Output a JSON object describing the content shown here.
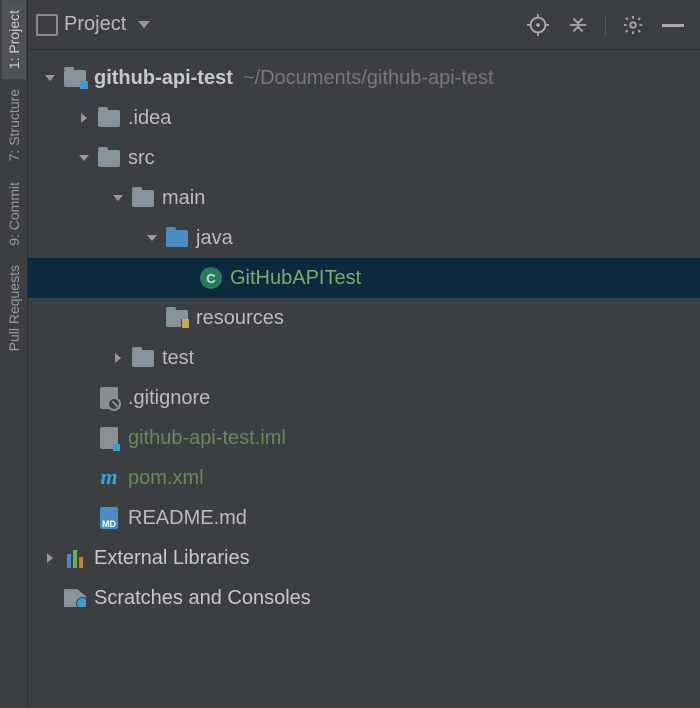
{
  "header": {
    "title": "Project"
  },
  "sideTabs": [
    "1: Project",
    "7: Structure",
    "9: Commit",
    "Pull Requests"
  ],
  "tree": {
    "root": {
      "name": "github-api-test",
      "path": "~/Documents/github-api-test"
    },
    "idea": ".idea",
    "src": "src",
    "main": "main",
    "java": "java",
    "class": "GitHubAPITest",
    "resources": "resources",
    "test": "test",
    "gitignore": ".gitignore",
    "iml": "github-api-test.iml",
    "pom": "pom.xml",
    "readme": "README.md",
    "external": "External Libraries",
    "scratches": "Scratches and Consoles"
  },
  "icons": {
    "classLetter": "C",
    "mdLabel": "MD",
    "mavenLetter": "m"
  }
}
